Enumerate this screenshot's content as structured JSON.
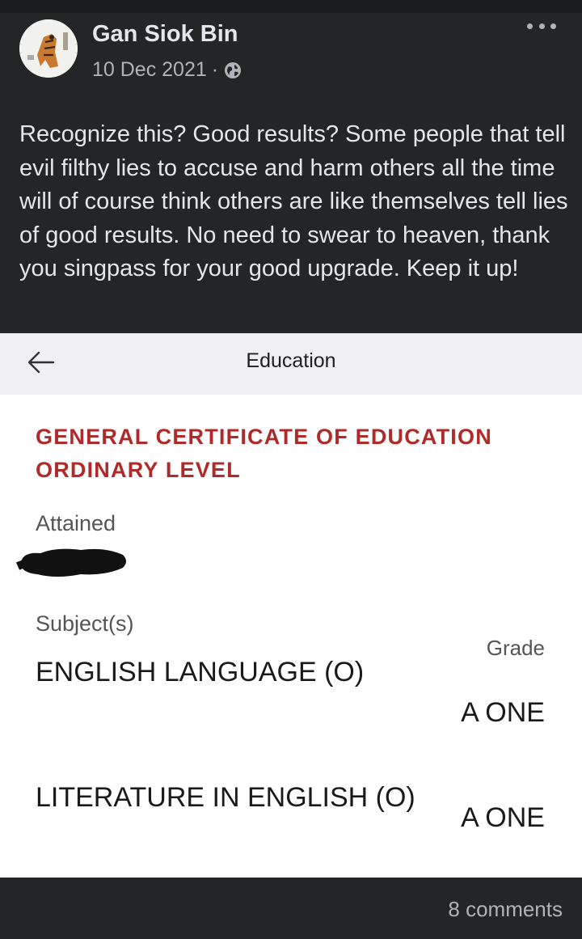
{
  "post": {
    "author": "Gan Siok Bin",
    "date": "10 Dec 2021",
    "separator": "·",
    "privacy_icon": "globe-icon",
    "more_icon": "more-dots-icon",
    "text": "Recognize this? Good results? Some people that tell evil filthy lies to accuse and harm others all the time will of course think others are like themselves tell lies of good results. No need to swear to heaven, thank you singpass for your good upgrade. Keep it up!"
  },
  "screenshot": {
    "header": {
      "back_icon": "back-arrow-icon",
      "title": "Education"
    },
    "certificate_title": "GENERAL CERTIFICATE OF EDUCATION ORDINARY LEVEL",
    "attained_label": "Attained",
    "subjects_label": "Subject(s)",
    "grade_label": "Grade",
    "subjects": [
      {
        "name": "ENGLISH LANGUAGE (O)",
        "grade": "A ONE"
      },
      {
        "name": "LITERATURE IN ENGLISH (O)",
        "grade": "A ONE"
      }
    ]
  },
  "footer": {
    "comments": "8 comments"
  },
  "colors": {
    "facebook_dark": "#242526",
    "cert_title_red": "#b12a2a",
    "screenshot_header_bg": "#f0f0f2"
  }
}
